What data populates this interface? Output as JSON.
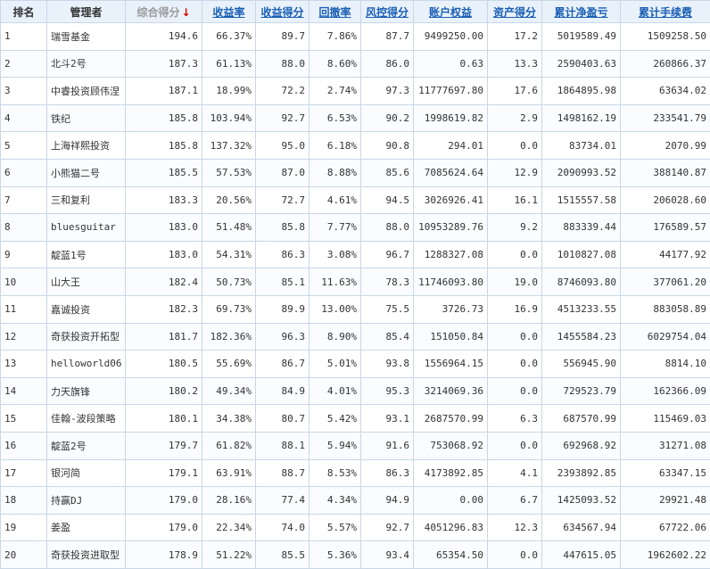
{
  "headers": {
    "rank": "排名",
    "manager": "管理者",
    "total_score": "综合得分",
    "sort_arrow": "↓",
    "return_rate": "收益率",
    "return_score": "收益得分",
    "drawdown": "回撤率",
    "risk_score": "风控得分",
    "equity": "账户权益",
    "asset_score": "资产得分",
    "net_profit": "累计净盈亏",
    "fee": "累计手续费"
  },
  "colors": {
    "header_bg": "#e9f1fb",
    "border": "#c9d7e6",
    "profit_red": "#e10000",
    "link_blue": "#1a5fb4"
  },
  "rows": [
    {
      "rank": "1",
      "name": "瑞雪基金",
      "total": "194.6",
      "ret": "66.37%",
      "ret_score": "89.7",
      "dd": "7.86%",
      "risk": "87.7",
      "equity": "9499250.00",
      "asset": "17.2",
      "profit": "5019589.49",
      "fee": "1509258.50"
    },
    {
      "rank": "2",
      "name": "北斗2号",
      "total": "187.3",
      "ret": "61.13%",
      "ret_score": "88.0",
      "dd": "8.60%",
      "risk": "86.0",
      "equity": "0.63",
      "asset": "13.3",
      "profit": "2590403.63",
      "fee": "260866.37"
    },
    {
      "rank": "3",
      "name": "中睿投资顾伟涅",
      "total": "187.1",
      "ret": "18.99%",
      "ret_score": "72.2",
      "dd": "2.74%",
      "risk": "97.3",
      "equity": "11777697.80",
      "asset": "17.6",
      "profit": "1864895.98",
      "fee": "63634.02"
    },
    {
      "rank": "4",
      "name": "铁纪",
      "total": "185.8",
      "ret": "103.94%",
      "ret_score": "92.7",
      "dd": "6.53%",
      "risk": "90.2",
      "equity": "1998619.82",
      "asset": "2.9",
      "profit": "1498162.19",
      "fee": "233541.79"
    },
    {
      "rank": "5",
      "name": "上海祥熙投资",
      "total": "185.8",
      "ret": "137.32%",
      "ret_score": "95.0",
      "dd": "6.18%",
      "risk": "90.8",
      "equity": "294.01",
      "asset": "0.0",
      "profit": "83734.01",
      "fee": "2070.99"
    },
    {
      "rank": "6",
      "name": "小熊猫二号",
      "total": "185.5",
      "ret": "57.53%",
      "ret_score": "87.0",
      "dd": "8.88%",
      "risk": "85.6",
      "equity": "7085624.64",
      "asset": "12.9",
      "profit": "2090993.52",
      "fee": "388140.87"
    },
    {
      "rank": "7",
      "name": "三和复利",
      "total": "183.3",
      "ret": "20.56%",
      "ret_score": "72.7",
      "dd": "4.61%",
      "risk": "94.5",
      "equity": "3026926.41",
      "asset": "16.1",
      "profit": "1515557.58",
      "fee": "206028.60"
    },
    {
      "rank": "8",
      "name": "bluesguitar",
      "total": "183.0",
      "ret": "51.48%",
      "ret_score": "85.8",
      "dd": "7.77%",
      "risk": "88.0",
      "equity": "10953289.76",
      "asset": "9.2",
      "profit": "883339.44",
      "fee": "176589.57"
    },
    {
      "rank": "9",
      "name": "靛蓝1号",
      "total": "183.0",
      "ret": "54.31%",
      "ret_score": "86.3",
      "dd": "3.08%",
      "risk": "96.7",
      "equity": "1288327.08",
      "asset": "0.0",
      "profit": "1010827.08",
      "fee": "44177.92"
    },
    {
      "rank": "10",
      "name": "山大王",
      "total": "182.4",
      "ret": "50.73%",
      "ret_score": "85.1",
      "dd": "11.63%",
      "risk": "78.3",
      "equity": "11746093.80",
      "asset": "19.0",
      "profit": "8746093.80",
      "fee": "377061.20"
    },
    {
      "rank": "11",
      "name": "嘉诚投资",
      "total": "182.3",
      "ret": "69.73%",
      "ret_score": "89.9",
      "dd": "13.00%",
      "risk": "75.5",
      "equity": "3726.73",
      "asset": "16.9",
      "profit": "4513233.55",
      "fee": "883058.89"
    },
    {
      "rank": "12",
      "name": "奇获投资开拓型",
      "total": "181.7",
      "ret": "182.36%",
      "ret_score": "96.3",
      "dd": "8.90%",
      "risk": "85.4",
      "equity": "151050.84",
      "asset": "0.0",
      "profit": "1455584.23",
      "fee": "6029754.04"
    },
    {
      "rank": "13",
      "name": "helloworld06",
      "total": "180.5",
      "ret": "55.69%",
      "ret_score": "86.7",
      "dd": "5.01%",
      "risk": "93.8",
      "equity": "1556964.15",
      "asset": "0.0",
      "profit": "556945.90",
      "fee": "8814.10"
    },
    {
      "rank": "14",
      "name": "力天旗锋",
      "total": "180.2",
      "ret": "49.34%",
      "ret_score": "84.9",
      "dd": "4.01%",
      "risk": "95.3",
      "equity": "3214069.36",
      "asset": "0.0",
      "profit": "729523.79",
      "fee": "162366.09"
    },
    {
      "rank": "15",
      "name": "佳翰-波段策略",
      "total": "180.1",
      "ret": "34.38%",
      "ret_score": "80.7",
      "dd": "5.42%",
      "risk": "93.1",
      "equity": "2687570.99",
      "asset": "6.3",
      "profit": "687570.99",
      "fee": "115469.03"
    },
    {
      "rank": "16",
      "name": "靛蓝2号",
      "total": "179.7",
      "ret": "61.82%",
      "ret_score": "88.1",
      "dd": "5.94%",
      "risk": "91.6",
      "equity": "753068.92",
      "asset": "0.0",
      "profit": "692968.92",
      "fee": "31271.08"
    },
    {
      "rank": "17",
      "name": "银河简",
      "total": "179.1",
      "ret": "63.91%",
      "ret_score": "88.7",
      "dd": "8.53%",
      "risk": "86.3",
      "equity": "4173892.85",
      "asset": "4.1",
      "profit": "2393892.85",
      "fee": "63347.15"
    },
    {
      "rank": "18",
      "name": "持赢DJ",
      "total": "179.0",
      "ret": "28.16%",
      "ret_score": "77.4",
      "dd": "4.34%",
      "risk": "94.9",
      "equity": "0.00",
      "asset": "6.7",
      "profit": "1425093.52",
      "fee": "29921.48"
    },
    {
      "rank": "19",
      "name": "姜盈",
      "total": "179.0",
      "ret": "22.34%",
      "ret_score": "74.0",
      "dd": "5.57%",
      "risk": "92.7",
      "equity": "4051296.83",
      "asset": "12.3",
      "profit": "634567.94",
      "fee": "67722.06"
    },
    {
      "rank": "20",
      "name": "奇获投资进取型",
      "total": "178.9",
      "ret": "51.22%",
      "ret_score": "85.5",
      "dd": "5.36%",
      "risk": "93.4",
      "equity": "65354.50",
      "asset": "0.0",
      "profit": "447615.05",
      "fee": "1962602.22"
    }
  ]
}
